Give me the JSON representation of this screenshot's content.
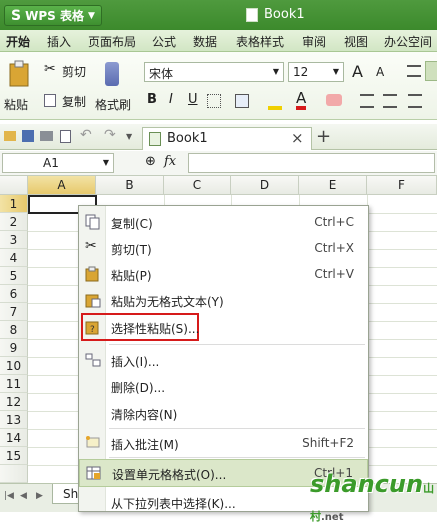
{
  "app": {
    "name": "WPS 表格",
    "doc_title": "Book1"
  },
  "ribbon_tabs": [
    "开始",
    "插入",
    "页面布局",
    "公式",
    "数据",
    "表格样式",
    "审阅",
    "视图",
    "办公空间"
  ],
  "ribbon": {
    "paste": "粘贴",
    "cut": "剪切",
    "copy": "复制",
    "format_painter": "格式刷",
    "font_name": "宋体",
    "font_size": "12",
    "bold": "B",
    "italic": "I",
    "underline": "U",
    "grow": "A",
    "shrink": "A"
  },
  "doc_tab": {
    "title": "Book1",
    "close": "×",
    "new": "+"
  },
  "formula_bar": {
    "cell_ref": "A1",
    "fx": "fx",
    "formula": ""
  },
  "columns": [
    "A",
    "B",
    "C",
    "D",
    "E",
    "F"
  ],
  "rows": [
    "1",
    "2",
    "3",
    "4",
    "5",
    "6",
    "7",
    "8",
    "9",
    "10",
    "11",
    "12",
    "13",
    "14",
    "15"
  ],
  "sheet_tab": "Sh",
  "context_menu": [
    {
      "label": "复制(C)",
      "shortcut": "Ctrl+C",
      "icon": "copy-icon"
    },
    {
      "label": "剪切(T)",
      "shortcut": "Ctrl+X",
      "icon": "scissors-icon"
    },
    {
      "label": "粘贴(P)",
      "shortcut": "Ctrl+V",
      "icon": "paste-icon"
    },
    {
      "label": "粘贴为无格式文本(Y)",
      "shortcut": "",
      "icon": "paste-text-icon"
    },
    {
      "label": "选择性粘贴(S)...",
      "shortcut": "",
      "icon": "paste-special-icon",
      "highlight_border": "#d61a1a"
    },
    {
      "label": "插入(I)...",
      "shortcut": "",
      "icon": "insert-icon"
    },
    {
      "label": "删除(D)...",
      "shortcut": "",
      "icon": ""
    },
    {
      "label": "清除内容(N)",
      "shortcut": "",
      "icon": ""
    },
    {
      "label": "插入批注(M)",
      "shortcut": "Shift+F2",
      "icon": "comment-icon"
    },
    {
      "label": "设置单元格格式(O)...",
      "shortcut": "Ctrl+1",
      "icon": "format-cells-icon",
      "hovered": true
    },
    {
      "label": "从下拉列表中选择(K)...",
      "shortcut": "",
      "icon": ""
    }
  ],
  "watermark": {
    "text": "shancun",
    "sub": ".net",
    "cn": "山村"
  },
  "colors": {
    "title_green": "#3c8a2c",
    "highlight": "#dbe7c9",
    "red_box": "#d61a1a",
    "watermark_green": "#3b9b2a"
  }
}
